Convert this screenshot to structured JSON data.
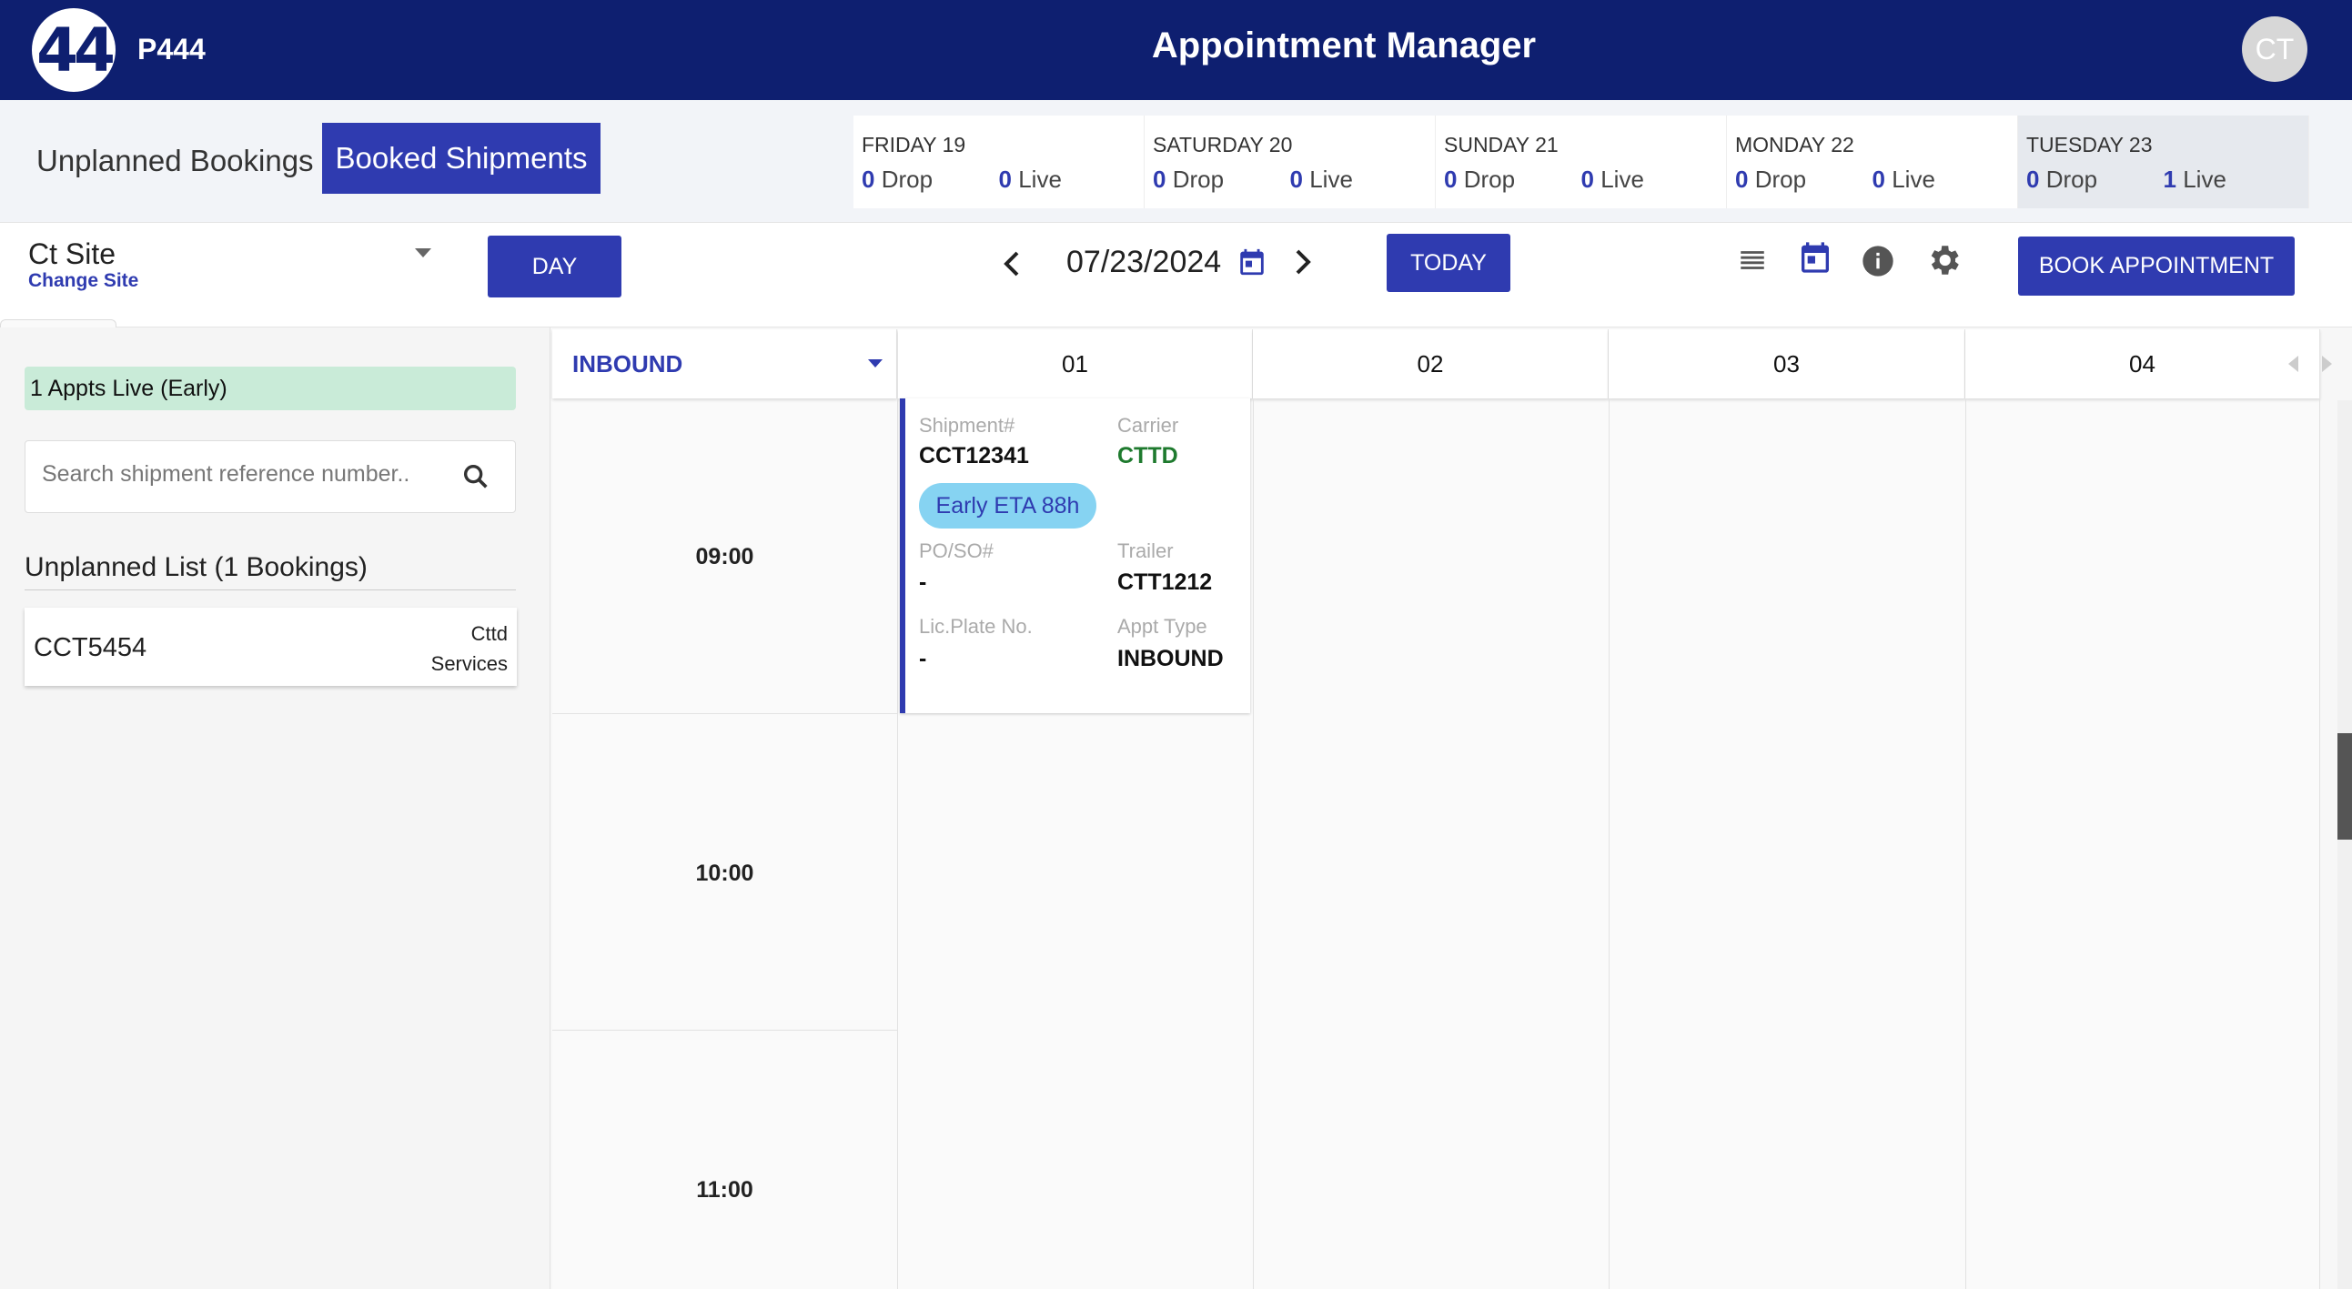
{
  "header": {
    "logo_text": "44",
    "org_code": "P444",
    "title": "Appointment Manager",
    "avatar_initials": "CT",
    "brand_color": "#0e1f70"
  },
  "tabs": {
    "unplanned": "Unplanned Bookings",
    "booked": "Booked Shipments"
  },
  "days": [
    {
      "name": "FRIDAY 19",
      "drop": "0",
      "live": "0"
    },
    {
      "name": "SATURDAY 20",
      "drop": "0",
      "live": "0"
    },
    {
      "name": "SUNDAY 21",
      "drop": "0",
      "live": "0"
    },
    {
      "name": "MONDAY 22",
      "drop": "0",
      "live": "0"
    },
    {
      "name": "TUESDAY 23",
      "drop": "0",
      "live": "1",
      "active": true
    }
  ],
  "labels": {
    "drop": "Drop",
    "live": "Live"
  },
  "toolbar": {
    "site_name": "Ct Site",
    "change_site": "Change Site",
    "view_button": "DAY",
    "date": "07/23/2024",
    "today_button": "TODAY",
    "book_button": "BOOK APPOINTMENT",
    "accent_color": "#2f3bb0"
  },
  "left_panel": {
    "live_badge": "1 Appts Live (Early)",
    "search_placeholder": "Search shipment reference number..",
    "unplanned_title": "Unplanned List (1 Bookings)",
    "bookings": [
      {
        "id": "CCT5454",
        "carrier": "Cttd Services"
      }
    ]
  },
  "calendar": {
    "direction": "INBOUND",
    "columns": [
      "01",
      "02",
      "03",
      "04"
    ],
    "times": [
      "09:00",
      "10:00",
      "11:00"
    ]
  },
  "appointment": {
    "shipment_label": "Shipment#",
    "shipment": "CCT12341",
    "carrier_label": "Carrier",
    "carrier": "CTTD",
    "eta_badge": "Early ETA 88h",
    "po_label": "PO/SO#",
    "po": "-",
    "trailer_label": "Trailer",
    "trailer": "CTT1212",
    "plate_label": "Lic.Plate No.",
    "plate": "-",
    "appt_type_label": "Appt Type",
    "appt_type": "INBOUND"
  }
}
